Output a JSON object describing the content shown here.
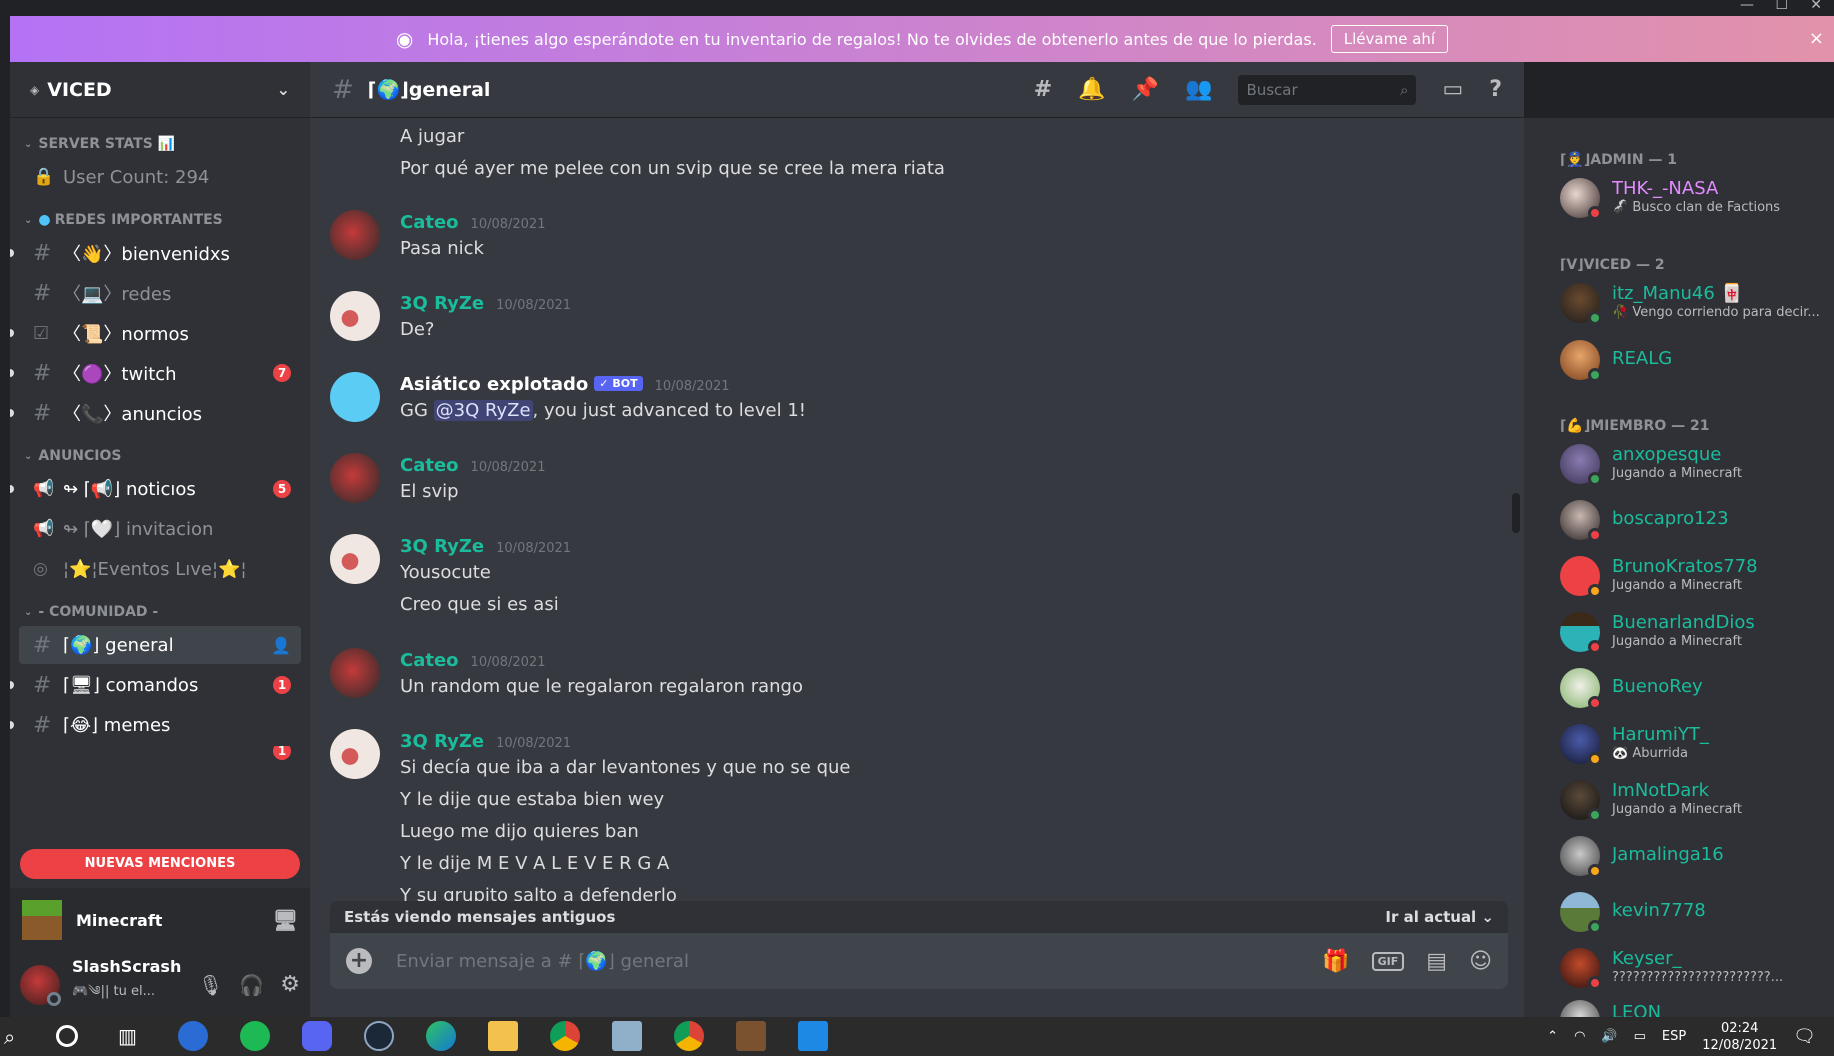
{
  "window": {
    "minimize": "—",
    "maximize": "☐",
    "close": "✕"
  },
  "banner": {
    "text": "Hola, ¡tienes algo esperándote en tu inventario de regalos! No te olvides de obtenerlo antes de que lo pierdas.",
    "cta": "Llévame ahí",
    "close": "×"
  },
  "server": {
    "name": "VICED"
  },
  "categories": {
    "stats": "SERVER STATS 📊",
    "redes": "REDES IMPORTANTES",
    "anuncios": "ANUNCIOS",
    "comunidad": "- COMUNIDAD -"
  },
  "channels": {
    "user_count": "User Count: 294",
    "bienvenidxs": "〈👋〉bienvenidxs",
    "redes": "〈💻〉redes",
    "normos": "〈📜〉normos",
    "twitch": "〈🟣〉twitch",
    "twitch_badge": "7",
    "anuncios": "〈📞〉anuncios",
    "noticias": "↬ ⌈📢⌋ noticıos",
    "noticias_badge": "5",
    "invitacion": "↬ ⌈🤍⌋ invitacion",
    "eventos": "¦⭐¦Eventos Lıve¦⭐¦",
    "general": "⌈🌍⌋ general",
    "comandos": "⌈🖥⌋ comandos",
    "comandos_badge": "1",
    "memes": "⌈😂⌋ memes",
    "imagenes_badge": "1"
  },
  "new_mentions": "NUEVAS MENCIONES",
  "activity": {
    "game": "Minecraft"
  },
  "user": {
    "name": "SlashScrash",
    "status": "🎮༄|| tu el..."
  },
  "header": {
    "channel": "⌈🌍⌋general",
    "search_placeholder": "Buscar"
  },
  "messages": {
    "m0_l1": "A jugar",
    "m0_l2": "Por qué ayer me pelee con un svip que se cree la mera riata",
    "m1_author": "Cateo",
    "m1_ts": "10/08/2021",
    "m1_l1": "Pasa nick",
    "m2_author": "3Q RyZe",
    "m2_ts": "10/08/2021",
    "m2_l1": "De?",
    "m3_author": "Asiático explotado",
    "m3_bot": "✓ BOT",
    "m3_ts": "10/08/2021",
    "m3_pre": "GG ",
    "m3_mention": "@3Q RyZe",
    "m3_post": ", you just advanced to level 1!",
    "m4_author": "Cateo",
    "m4_ts": "10/08/2021",
    "m4_l1": "El svip",
    "m5_author": "3Q RyZe",
    "m5_ts": "10/08/2021",
    "m5_l1": "Yousocute",
    "m5_l2": "Creo que si es asi",
    "m6_author": "Cateo",
    "m6_ts": "10/08/2021",
    "m6_l1": "Un random que le regalaron regalaron rango",
    "m7_author": "3Q RyZe",
    "m7_ts": "10/08/2021",
    "m7_l1": "Si decía que iba a dar levantones y que no se que",
    "m7_l2": "Y le dije que estaba bien wey",
    "m7_l3": "Luego me dijo quieres ban",
    "m7_l4": "Y le dije M E V A L E V E R G A",
    "m7_l5": "Y su grupito salto a defenderlo"
  },
  "old_messages": {
    "text": "Estás viendo mensajes antiguos",
    "jump": "Ir al actual ⌄"
  },
  "composer": {
    "placeholder": "Enviar mensaje a # ⌈🌍⌋ general",
    "gif": "GIF"
  },
  "members": {
    "admin_role": "⌈👮⌋ADMIN — 1",
    "viced_role": "⌈V⌋VICED — 2",
    "miembro_role": "⌈💪⌋MIEMBRO — 21",
    "m_thk": "THK-_-NASA",
    "m_thk_s": "🦨 Busco clan de Factions",
    "m_itz": "itz_Manu46 🀄",
    "m_itz_s": "🥀 Vengo corriendo para decir...",
    "m_realg": "REALG",
    "m_anx": "anxopesque",
    "m_anx_s": "Jugando a Minecraft",
    "m_bos": "boscapro123",
    "m_bru": "BrunoKratos778",
    "m_bru_s": "Jugando a Minecraft",
    "m_bue": "BuenarlandDios",
    "m_bue_s": "Jugando a Minecraft",
    "m_buer": "BuenoRey",
    "m_har": "HarumiYT_",
    "m_har_s": "🐼 Aburrida",
    "m_imn": "ImNotDark",
    "m_imn_s": "Jugando a Minecraft",
    "m_jam": "Jamalinga16",
    "m_kev": "kevin7778",
    "m_key": "Keyser_",
    "m_key_s": "???????????????????????...",
    "m_leon": "LEON"
  },
  "taskbar": {
    "lang": "ESP",
    "time": "02:24",
    "date": "12/08/2021"
  },
  "colors": {
    "admin": "#e38bff",
    "member": "#1abc9c",
    "online": "#3ba55c",
    "dnd": "#ed4245",
    "idle": "#faa61a"
  }
}
